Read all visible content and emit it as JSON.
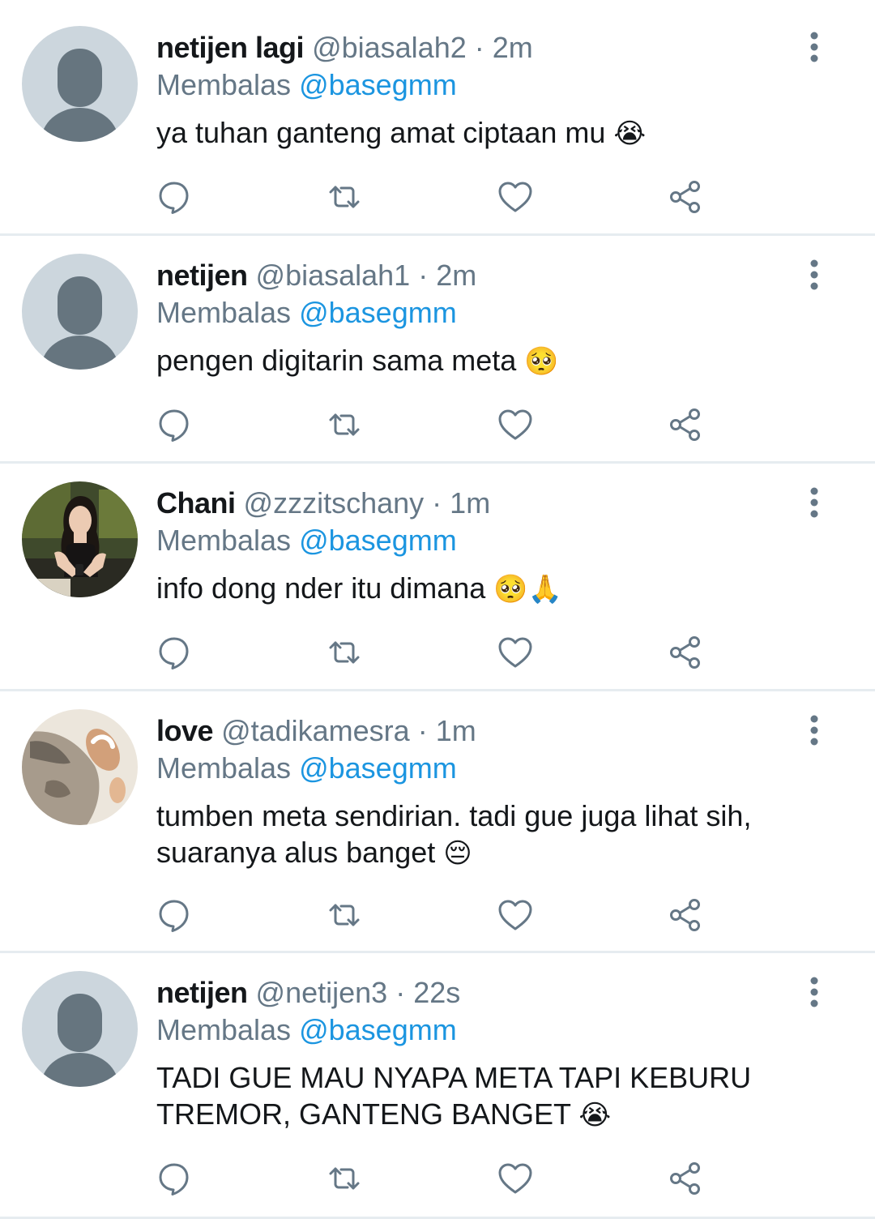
{
  "tweets": [
    {
      "name": "netijen lagi",
      "handle": "@biasalah2",
      "separator": "·",
      "time": "2m",
      "replying_prefix": "Membalas",
      "replying_to": "@basegmm",
      "text": "ya tuhan ganteng amat ciptaan mu",
      "emoji": "😭",
      "avatar": "default-avatar"
    },
    {
      "name": "netijen",
      "handle": "@biasalah1",
      "separator": "·",
      "time": "2m",
      "replying_prefix": "Membalas",
      "replying_to": "@basegmm",
      "text": "pengen digitarin sama meta",
      "emoji": "🥺",
      "avatar": "default-avatar"
    },
    {
      "name": "Chani",
      "handle": "@zzzitschany",
      "separator": "·",
      "time": "1m",
      "replying_prefix": "Membalas",
      "replying_to": "@basegmm",
      "text": "info dong nder itu dimana",
      "emoji": "🥺🙏",
      "avatar": "photo-avatar-girl"
    },
    {
      "name": "love",
      "handle": "@tadikamesra",
      "separator": "·",
      "time": "1m",
      "replying_prefix": "Membalas",
      "replying_to": "@basegmm",
      "text": "tumben meta sendirian. tadi gue juga lihat sih, suaranya alus banget",
      "emoji": "😔",
      "avatar": "photo-avatar-cat"
    },
    {
      "name": "netijen",
      "handle": "@netijen3",
      "separator": "·",
      "time": "22s",
      "replying_prefix": "Membalas",
      "replying_to": "@basegmm",
      "text": "TADI GUE MAU NYAPA META TAPI KEBURU TREMOR, GANTENG BANGET",
      "emoji": "😭",
      "avatar": "default-avatar"
    }
  ],
  "colors": {
    "name": "#14171a",
    "muted": "#657786",
    "link": "#1b95e0",
    "divider": "#e6ecf0",
    "default_avatar_bg": "#ccd6dd",
    "default_avatar_fg": "#66757f"
  },
  "icons": [
    "reply-icon",
    "retweet-icon",
    "like-icon",
    "share-icon",
    "more-options-icon"
  ]
}
